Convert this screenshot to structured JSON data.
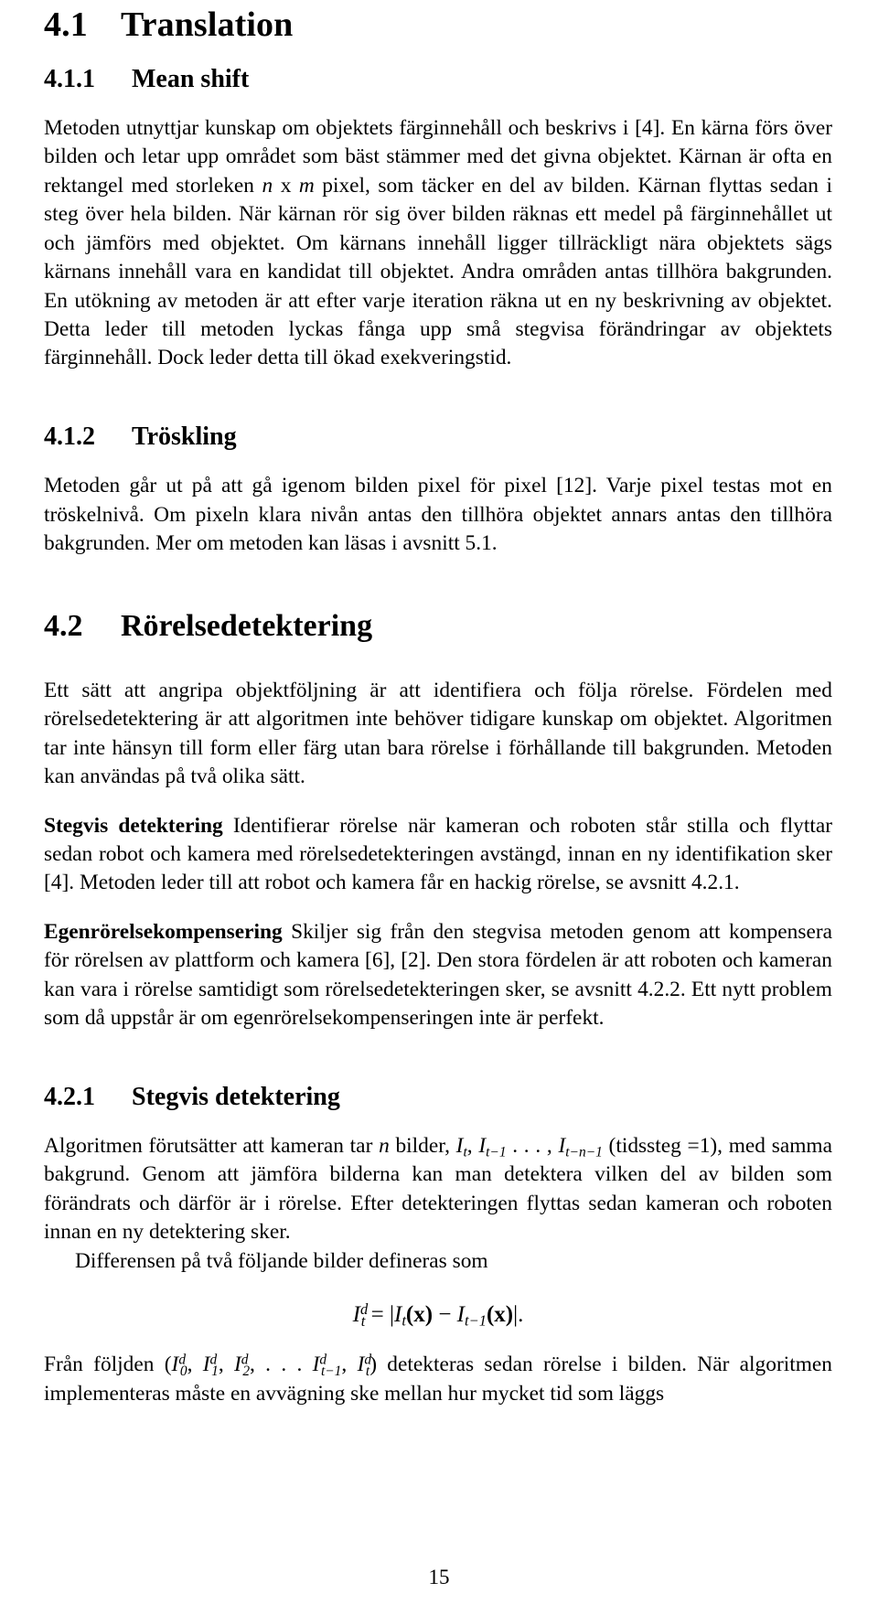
{
  "document": {
    "page_number": "15",
    "language": "sv"
  },
  "sections": {
    "translation": {
      "number": "4.1",
      "title": "Translation"
    },
    "mean_shift": {
      "number": "4.1.1",
      "title": "Mean shift",
      "paragraph_part1": "Metoden utnyttjar kunskap om objektets färginnehåll och beskrivs i [4]. En kärna förs över bilden och letar upp området som bäst stämmer med det givna objektet. Kärnan är ofta en rektangel med storleken ",
      "math_inline_n": "n",
      "math_inline_x": " x ",
      "math_inline_m": "m",
      "paragraph_part2": " pixel, som täcker en del av bilden. Kärnan flyttas sedan i steg över hela bilden. När kärnan rör sig över bilden räknas ett medel på färginnehållet ut och jämförs med objektet. Om kärnans innehåll ligger tillräckligt nära objektets sägs kärnans innehåll vara en kandidat till objektet. Andra områden antas tillhöra bakgrunden. En utökning av metoden är att efter varje iteration räkna ut en ny beskrivning av objektet. Detta leder till metoden lyckas fånga upp små stegvisa förändringar av objektets färginnehåll. Dock leder detta till ökad exekveringstid."
    },
    "troskling": {
      "number": "4.1.2",
      "title": "Tröskling",
      "paragraph": "Metoden går ut på att gå igenom bilden pixel för pixel [12]. Varje pixel testas mot en tröskelnivå. Om pixeln klara nivån antas den tillhöra objektet annars antas den tillhöra bakgrunden. Mer om metoden kan läsas i avsnitt 5.1."
    },
    "rorelsedetektering": {
      "number": "4.2",
      "title": "Rörelsedetektering",
      "intro_paragraph": "Ett sätt att angripa objektföljning är att identifiera och följa rörelse. Fördelen med rörelsedetektering är att algoritmen inte behöver tidigare kunskap om objektet. Algoritmen tar inte hänsyn till form eller färg utan bara rörelse i förhållande till bakgrunden. Metoden kan användas på två olika sätt.",
      "stegvis": {
        "lead": "Stegvis detektering",
        "text": " Identifierar rörelse när kameran och roboten står stilla och flyttar sedan robot och kamera med rörelsedetekteringen avstängd, innan en ny identifikation sker [4]. Metoden leder till att robot och kamera får en hackig rörelse, se avsnitt 4.2.1."
      },
      "egen": {
        "lead": "Egenrörelsekompensering",
        "text": " Skiljer sig från den stegvisa metoden genom att kompensera för rörelsen av plattform och kamera [6], [2]. Den stora fördelen är att roboten och kameran kan vara i rörelse samtidigt som rörelsedetekteringen sker, se avsnitt 4.2.2. Ett nytt problem som då uppstår är om egenrörelsekompenseringen inte är perfekt."
      }
    },
    "stegvis_detektering": {
      "number": "4.2.1",
      "title": "Stegvis detektering",
      "para_a": "Algoritmen förutsätter att kameran tar ",
      "math_n": "n",
      "para_b": " bilder, ",
      "math_It": "I",
      "math_It_sub": "t",
      "para_c": ", ",
      "math_It1": "I",
      "math_It1_sub": "t−1",
      "para_d": " . . . , ",
      "math_Itn1": "I",
      "math_Itn1_sub": "t−n−1",
      "para_e": " (tidssteg =1), med samma bakgrund. Genom att jämföra bilderna kan man detektera vilken del av bilden som förändrats och därför är i rörelse. Efter detekteringen flyttas sedan kameran och roboten innan en ny detektering sker.",
      "para_diff": "Differensen på två följande bilder defineras som",
      "equation": {
        "lhs_base": "I",
        "lhs_sup": "d",
        "lhs_sub": "t",
        "eq": "=",
        "bar_open": "|",
        "t1_base": "I",
        "t1_sub": "t",
        "t1_arg": "(x)",
        "minus": "−",
        "t2_base": "I",
        "t2_sub": "t−1",
        "t2_arg": "(x)",
        "bar_close": "|",
        "period": "."
      },
      "para_f": "Från följden (",
      "seq": {
        "i0": "I",
        "i0_sup": "d",
        "i0_sub": "0",
        "i1": "I",
        "i1_sup": "d",
        "i1_sub": "1",
        "i2": "I",
        "i2_sup": "d",
        "i2_sub": "2",
        "dots": ",  . . . ",
        "itm1": "I",
        "itm1_sup": "d",
        "itm1_sub": "t−1",
        "it": "I",
        "it_sup": "d",
        "it_sub": "t"
      },
      "para_g": ") detekteras sedan rörelse i bilden. När algoritmen implementeras måste en avvägning ske mellan hur mycket tid som läggs"
    }
  }
}
